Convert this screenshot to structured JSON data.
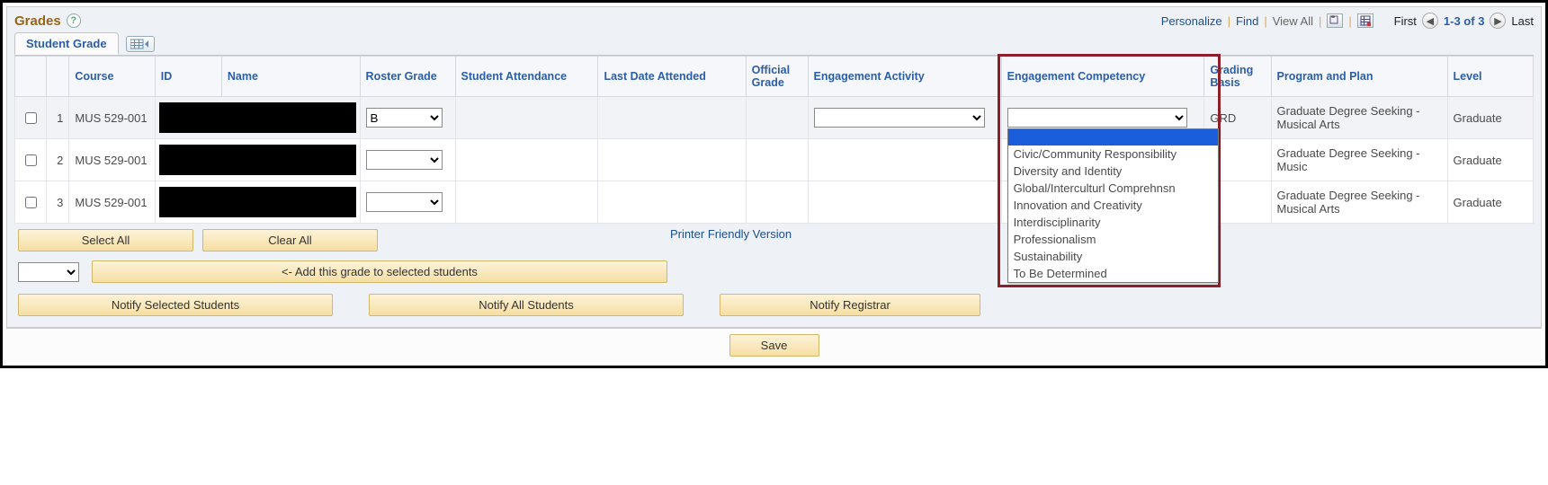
{
  "header": {
    "title": "Grades",
    "tab": "Student Grade",
    "personalize": "Personalize",
    "find": "Find",
    "viewall": "View All",
    "first": "First",
    "range": "1-3 of 3",
    "last": "Last"
  },
  "columns": {
    "course": "Course",
    "id": "ID",
    "name": "Name",
    "roster": "Roster Grade",
    "attendance": "Student Attendance",
    "lastdate": "Last Date Attended",
    "official": "Official Grade",
    "engact": "Engagement Activity",
    "engcomp": "Engagement Competency",
    "basis": "Grading Basis",
    "plan": "Program and Plan",
    "level": "Level"
  },
  "rows": [
    {
      "num": "1",
      "course": "MUS 529-001",
      "roster": "B",
      "basis": "GRD",
      "plan": "Graduate Degree Seeking - Musical Arts",
      "level": "Graduate"
    },
    {
      "num": "2",
      "course": "MUS 529-001",
      "roster": "",
      "basis": "",
      "plan": "Graduate Degree Seeking - Music",
      "level": "Graduate"
    },
    {
      "num": "3",
      "course": "MUS 529-001",
      "roster": "",
      "basis": "",
      "plan": "Graduate Degree Seeking - Musical Arts",
      "level": "Graduate"
    }
  ],
  "dropdown_options": [
    "Civic/Community Responsibility",
    "Diversity and Identity",
    "Global/Interculturl Comprehnsn",
    "Innovation and Creativity",
    "Interdisciplinarity",
    "Professionalism",
    "Sustainability",
    "To Be Determined"
  ],
  "buttons": {
    "selectall": "Select All",
    "clearall": "Clear All",
    "addgrade": "<- Add this grade to selected students",
    "notifysel": "Notify Selected Students",
    "notifyall": "Notify All Students",
    "notifyreg": "Notify Registrar",
    "save": "Save",
    "printer": "Printer Friendly Version"
  }
}
